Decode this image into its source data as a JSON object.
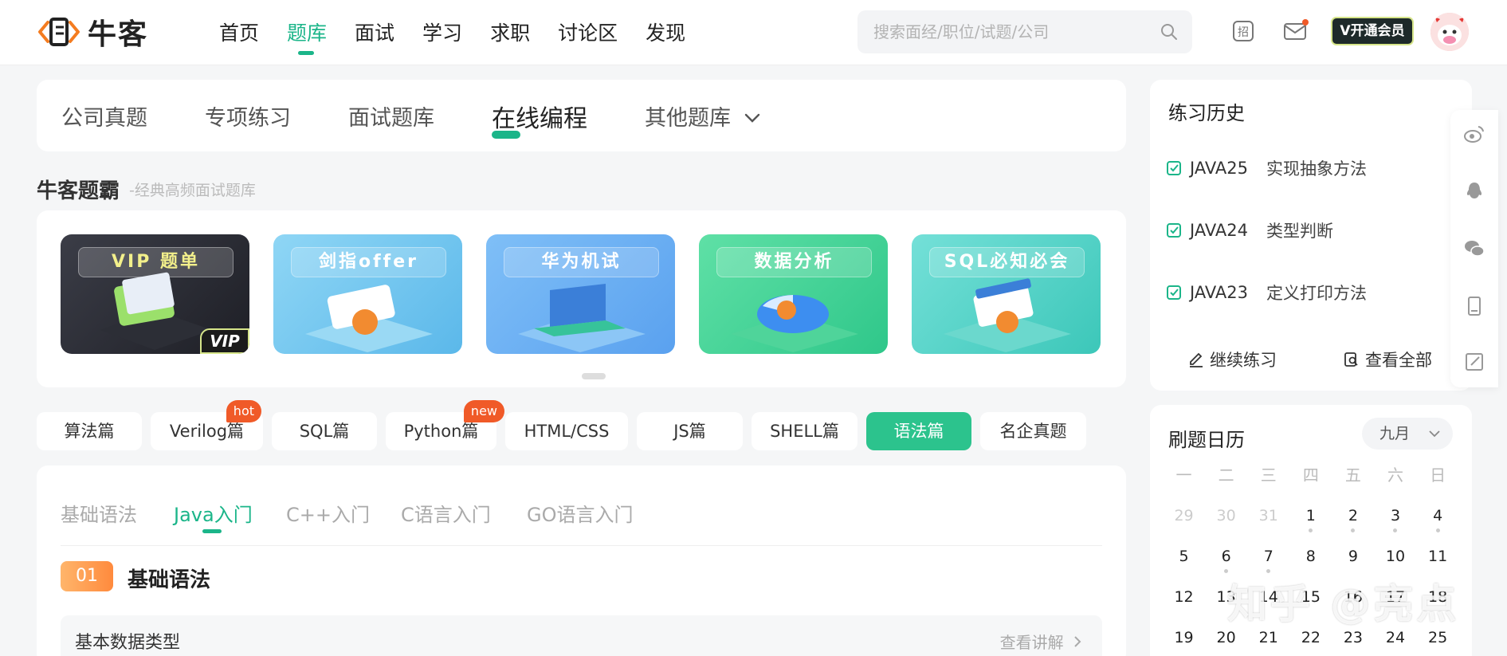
{
  "logo": {
    "text": "牛客"
  },
  "nav": {
    "items": [
      "首页",
      "题库",
      "面试",
      "学习",
      "求职",
      "讨论区",
      "发现"
    ],
    "active_index": 1
  },
  "search": {
    "placeholder": "搜索面经/职位/试题/公司"
  },
  "header": {
    "vip_label": "开通会员",
    "vip_prefix": "V"
  },
  "subtabs": {
    "items": [
      "公司真题",
      "专项练习",
      "面试题库",
      "在线编程",
      "其他题库"
    ],
    "active_index": 3
  },
  "section": {
    "title": "牛客题霸",
    "subtitle": "-经典高频面试题库"
  },
  "banners": [
    {
      "label": "VIP 题单",
      "badge": "VIP"
    },
    {
      "label": "剑指offer"
    },
    {
      "label": "华为机试"
    },
    {
      "label": "数据分析"
    },
    {
      "label": "SQL必知必会"
    }
  ],
  "lang_tabs": [
    {
      "label": "算法篇"
    },
    {
      "label": "Verilog篇",
      "badge": "hot"
    },
    {
      "label": "SQL篇"
    },
    {
      "label": "Python篇",
      "badge": "new"
    },
    {
      "label": "HTML/CSS"
    },
    {
      "label": "JS篇"
    },
    {
      "label": "SHELL篇"
    },
    {
      "label": "语法篇",
      "active": true
    },
    {
      "label": "名企真题"
    }
  ],
  "content": {
    "tabs": [
      "基础语法",
      "Java入门",
      "C++入门",
      "C语言入门",
      "GO语言入门"
    ],
    "active_index": 1,
    "chapter_num": "01",
    "chapter_title": "基础语法",
    "row_title": "基本数据类型",
    "row_link": "查看讲解"
  },
  "history": {
    "title": "练习历史",
    "items": [
      {
        "code": "JAVA25",
        "name": "实现抽象方法"
      },
      {
        "code": "JAVA24",
        "name": "类型判断"
      },
      {
        "code": "JAVA23",
        "name": "定义打印方法"
      }
    ],
    "continue_label": "继续练习",
    "view_all_label": "查看全部"
  },
  "calendar": {
    "title": "刷题日历",
    "month": "九月",
    "weekdays": [
      "一",
      "二",
      "三",
      "四",
      "五",
      "六",
      "日"
    ],
    "weeks": [
      [
        "29",
        "30",
        "31",
        "1",
        "2",
        "3",
        "4"
      ],
      [
        "5",
        "6",
        "7",
        "8",
        "9",
        "10",
        "11"
      ],
      [
        "12",
        "13",
        "14",
        "15",
        "16",
        "17",
        "18"
      ],
      [
        "19",
        "20",
        "21",
        "22",
        "23",
        "24",
        "25"
      ]
    ]
  },
  "watermark": "知乎 @亮点",
  "colors": {
    "accent": "#1bb589",
    "hot": "#f05a28"
  }
}
